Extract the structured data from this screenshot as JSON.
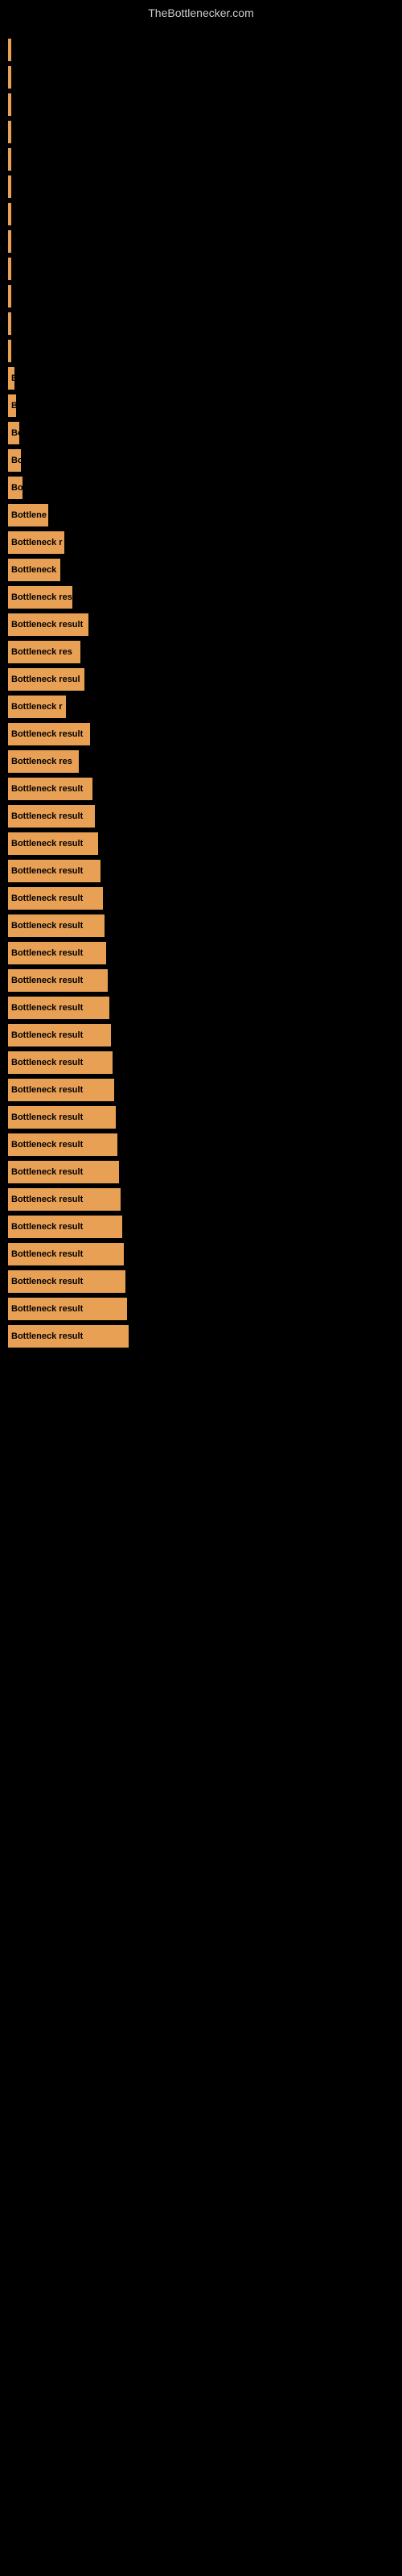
{
  "site": {
    "title": "TheBottlenecker.com"
  },
  "bars": [
    {
      "label": "",
      "width": 2,
      "text": ""
    },
    {
      "label": "",
      "width": 2,
      "text": ""
    },
    {
      "label": "",
      "width": 2,
      "text": ""
    },
    {
      "label": "",
      "width": 2,
      "text": ""
    },
    {
      "label": "",
      "width": 2,
      "text": ""
    },
    {
      "label": "",
      "width": 2,
      "text": ""
    },
    {
      "label": "",
      "width": 2,
      "text": ""
    },
    {
      "label": "",
      "width": 2,
      "text": ""
    },
    {
      "label": "",
      "width": 2,
      "text": ""
    },
    {
      "label": "",
      "width": 2,
      "text": ""
    },
    {
      "label": "",
      "width": 3,
      "text": ""
    },
    {
      "label": "",
      "width": 3,
      "text": ""
    },
    {
      "label": "B",
      "width": 8,
      "text": "B"
    },
    {
      "label": "B",
      "width": 10,
      "text": "B"
    },
    {
      "label": "Bo",
      "width": 14,
      "text": "Bo"
    },
    {
      "label": "Bo",
      "width": 16,
      "text": "Bo"
    },
    {
      "label": "Bo",
      "width": 18,
      "text": "Bo"
    },
    {
      "label": "Bottlene",
      "width": 50,
      "text": "Bottlene"
    },
    {
      "label": "Bottleneck r",
      "width": 70,
      "text": "Bottleneck r"
    },
    {
      "label": "Bottleneck",
      "width": 65,
      "text": "Bottleneck"
    },
    {
      "label": "Bottleneck res",
      "width": 80,
      "text": "Bottleneck res"
    },
    {
      "label": "Bottleneck result",
      "width": 100,
      "text": "Bottleneck result"
    },
    {
      "label": "Bottleneck res",
      "width": 90,
      "text": "Bottleneck res"
    },
    {
      "label": "Bottleneck resul",
      "width": 95,
      "text": "Bottleneck resul"
    },
    {
      "label": "Bottleneck r",
      "width": 72,
      "text": "Bottleneck r"
    },
    {
      "label": "Bottleneck result",
      "width": 102,
      "text": "Bottleneck result"
    },
    {
      "label": "Bottleneck res",
      "width": 88,
      "text": "Bottleneck res"
    },
    {
      "label": "Bottleneck result",
      "width": 105,
      "text": "Bottleneck result"
    },
    {
      "label": "Bottleneck result",
      "width": 108,
      "text": "Bottleneck result"
    },
    {
      "label": "Bottleneck result",
      "width": 112,
      "text": "Bottleneck result"
    },
    {
      "label": "Bottleneck result",
      "width": 115,
      "text": "Bottleneck result"
    },
    {
      "label": "Bottleneck result",
      "width": 118,
      "text": "Bottleneck result"
    },
    {
      "label": "Bottleneck result",
      "width": 120,
      "text": "Bottleneck result"
    },
    {
      "label": "Bottleneck result",
      "width": 122,
      "text": "Bottleneck result"
    },
    {
      "label": "Bottleneck result",
      "width": 124,
      "text": "Bottleneck result"
    },
    {
      "label": "Bottleneck result",
      "width": 126,
      "text": "Bottleneck result"
    },
    {
      "label": "Bottleneck result",
      "width": 128,
      "text": "Bottleneck result"
    },
    {
      "label": "Bottleneck result",
      "width": 130,
      "text": "Bottleneck result"
    },
    {
      "label": "Bottleneck result",
      "width": 132,
      "text": "Bottleneck result"
    },
    {
      "label": "Bottleneck result",
      "width": 134,
      "text": "Bottleneck result"
    },
    {
      "label": "Bottleneck result",
      "width": 136,
      "text": "Bottleneck result"
    },
    {
      "label": "Bottleneck result",
      "width": 138,
      "text": "Bottleneck result"
    },
    {
      "label": "Bottleneck result",
      "width": 140,
      "text": "Bottleneck result"
    },
    {
      "label": "Bottleneck result",
      "width": 142,
      "text": "Bottleneck result"
    },
    {
      "label": "Bottleneck result",
      "width": 144,
      "text": "Bottleneck result"
    },
    {
      "label": "Bottleneck result",
      "width": 146,
      "text": "Bottleneck result"
    },
    {
      "label": "Bottleneck result",
      "width": 148,
      "text": "Bottleneck result"
    },
    {
      "label": "Bottleneck result",
      "width": 150,
      "text": "Bottleneck result"
    }
  ]
}
